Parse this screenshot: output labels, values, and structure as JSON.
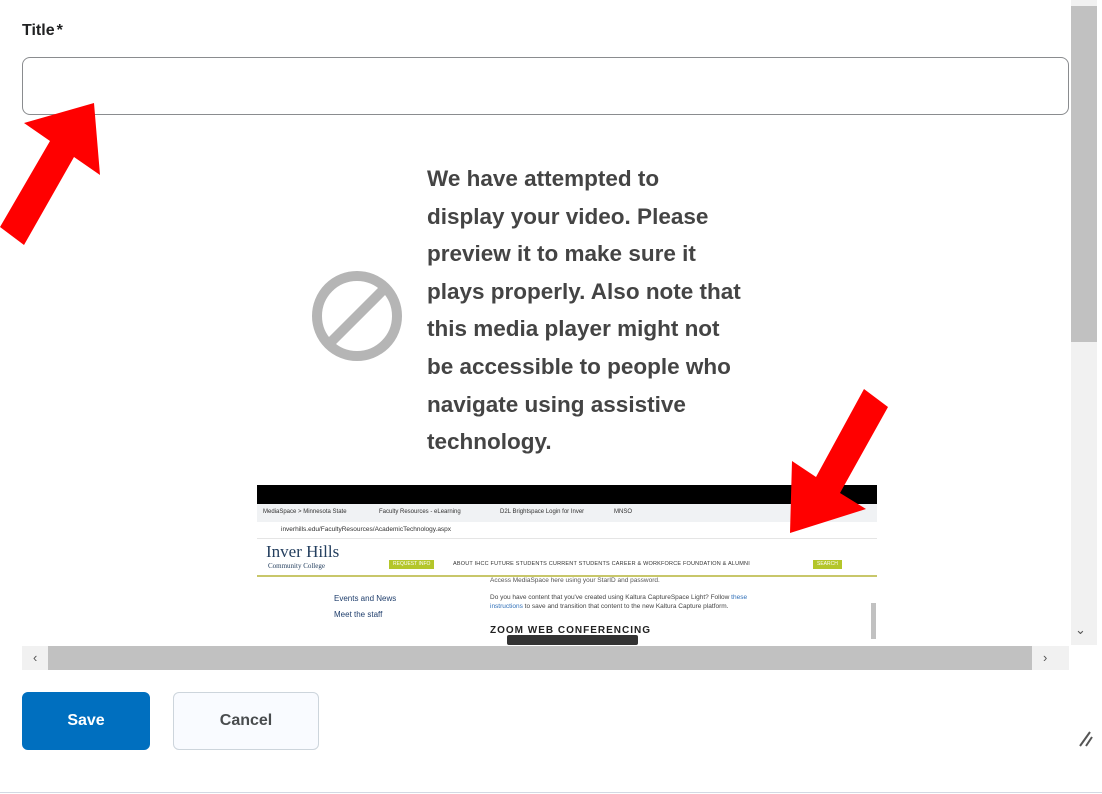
{
  "form": {
    "title_label": "Title",
    "required_mark": "*",
    "title_value": ""
  },
  "message": {
    "lines": [
      "We have attempted to",
      "display your video. Please",
      "preview it to make sure it",
      "plays properly. Also note that",
      "this media player might not",
      "be accessible to people who",
      "navigate using assistive",
      "technology."
    ]
  },
  "embedded_screenshot": {
    "tabs": [
      "MediaSpace > Minnesota State",
      "Faculty Resources - eLearning",
      "D2L Brightspace Login for Inver",
      "MNSO"
    ],
    "url": "inverhills.edu/FacultyResources/AcademicTechnology.aspx",
    "logo": "Inver Hills",
    "logo_sub": "Community College",
    "request_info": "REQUEST INFO",
    "menu": "ABOUT IHCC    FUTURE STUDENTS    CURRENT STUDENTS    CAREER & WORKFORCE    FOUNDATION & ALUMNI",
    "search": "SEARCH",
    "side_links": [
      "Events and News",
      "Meet the staff"
    ],
    "p1": "Access MediaSpace here using your StarID and password.",
    "p2_a": "Do you have content that you've created using Kaltura CaptureSpace Light? Follow ",
    "p2_link": "these",
    "p3_link": "instructions",
    "p3_b": " to save and transition that content to the new Kaltura Capture platform.",
    "heading": "ZOOM WEB CONFERENCING"
  },
  "buttons": {
    "save": "Save",
    "cancel": "Cancel"
  },
  "icons": {
    "blocked": "blocked-icon",
    "arrow_color": "#ff0000"
  },
  "colors": {
    "primary": "#006fbf"
  }
}
